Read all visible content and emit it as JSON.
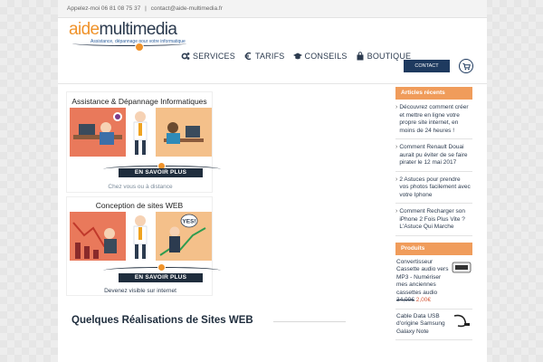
{
  "topbar": {
    "phone": "Appelez-moi 06 81 08 75 37",
    "separator": "|",
    "email": "contact@aide-multimedia.fr"
  },
  "logo": {
    "part1": "aide",
    "part2": "multimedia",
    "tagline": "Assistance, dépannage pour votre informatique"
  },
  "nav": [
    {
      "label": "SERVICES",
      "icon": "cogs-icon"
    },
    {
      "label": "TARIFS",
      "icon": "euro-icon"
    },
    {
      "label": "CONSEILS",
      "icon": "graduation-cap-icon"
    },
    {
      "label": "BOUTIQUE",
      "icon": "shopping-bag-icon"
    }
  ],
  "contact_button": "CONTACT",
  "promos": [
    {
      "title": "Assistance & Dépannage Informatiques",
      "button": "EN SAVOIR PLUS",
      "subtitle": "Chez vous ou à distance"
    },
    {
      "title": "Conception de sites WEB",
      "button": "EN SAVOIR PLUS",
      "subtitle": "Devenez visible sur internet",
      "bubble": "YES!"
    }
  ],
  "section_heading": "Quelques Réalisations de Sites WEB",
  "sidebar": {
    "recent_title": "Articles récents",
    "recent_articles": [
      "Découvrez comment créer et mettre en ligne votre propre site internet, en moins de 24 heures !",
      "Comment Renault Douai aurait pu éviter de se faire pirater le 12 mai 2017",
      "2 Astuces pour prendre vos photos facilement avec votre Iphone",
      "Comment Recharger son iPhone 2 Fois Plus Vite ? L'Astuce Qui Marche"
    ],
    "products_title": "Produits",
    "products": [
      {
        "name": "Convertisseur Cassette audio vers MP3 - Numériser mes anciennes cassettes audio",
        "old_price": "34,00€",
        "new_price": "2,00€"
      },
      {
        "name": "Cable Data USB d'origine Samsung Galaxy Note"
      }
    ]
  },
  "colors": {
    "accent_orange": "#f0932b",
    "navy": "#1e3a5f",
    "widget_header": "#f09c5b"
  }
}
